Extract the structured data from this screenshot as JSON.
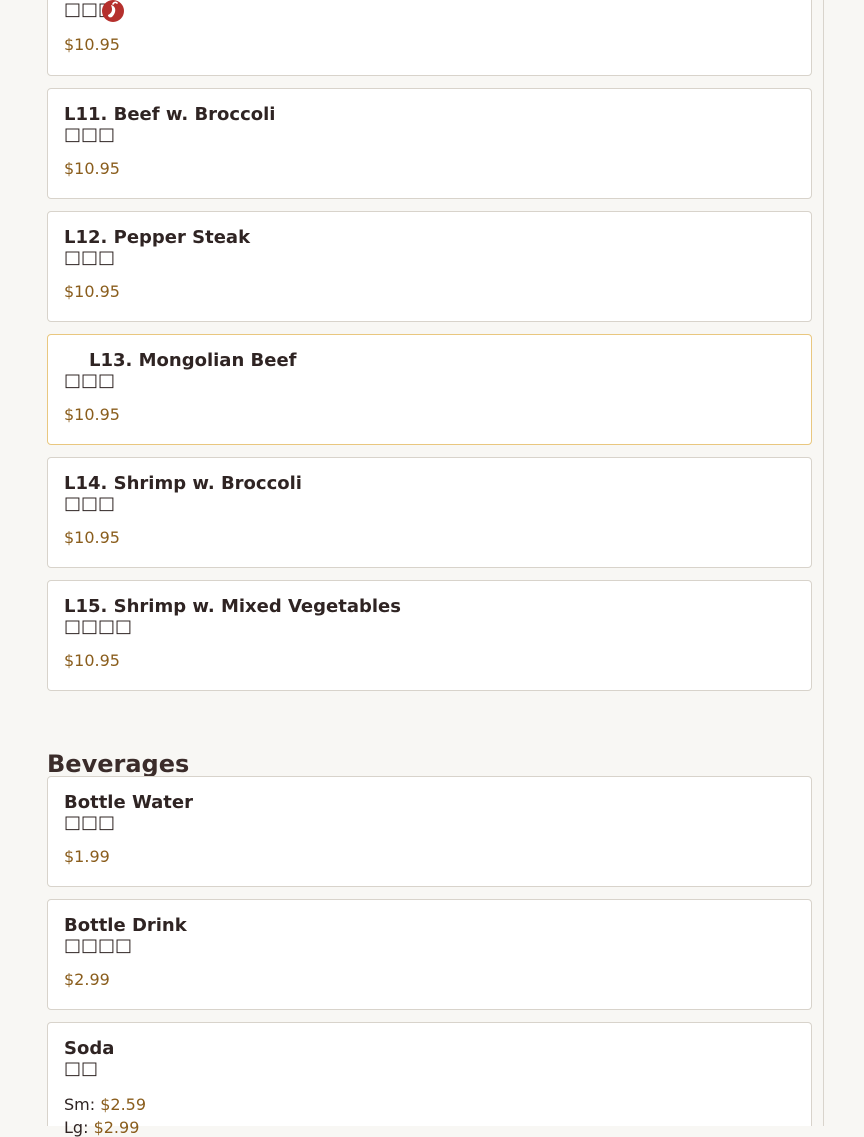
{
  "menu": {
    "lunch_items": [
      {
        "name": "",
        "chinese": "□□□",
        "price": "$10.95",
        "spicy": true,
        "icon": "chili-icon",
        "icon_color": "#b5302d"
      },
      {
        "name": "L11. Beef w. Broccoli",
        "chinese": "□□□",
        "price": "$10.95"
      },
      {
        "name": "L12. Pepper Steak",
        "chinese": "□□□",
        "price": "$10.95"
      },
      {
        "name": "L13. Mongolian Beef",
        "chinese": "□□□",
        "price": "$10.95",
        "highlighted": true
      },
      {
        "name": "L14. Shrimp w. Broccoli",
        "chinese": "□□□",
        "price": "$10.95"
      },
      {
        "name": "L15. Shrimp w. Mixed Vegetables",
        "chinese": "□□□□",
        "price": "$10.95"
      }
    ]
  },
  "beverages": {
    "title": "Beverages",
    "items": [
      {
        "name": "Bottle Water",
        "chinese": "□□□",
        "price": "$1.99"
      },
      {
        "name": "Bottle Drink",
        "chinese": "□□□□",
        "price": "$2.99"
      },
      {
        "name": "Soda",
        "chinese": "□□",
        "sizes": [
          {
            "label": "Sm:",
            "price": "$2.59"
          },
          {
            "label": "Lg:",
            "price": "$2.99"
          }
        ]
      }
    ]
  },
  "colors": {
    "card_border": "#d8d3cb",
    "highlight_border": "#e9c77f",
    "price": "#8a5d1c",
    "text": "#2f2423",
    "page_background": "#f8f7f4"
  }
}
